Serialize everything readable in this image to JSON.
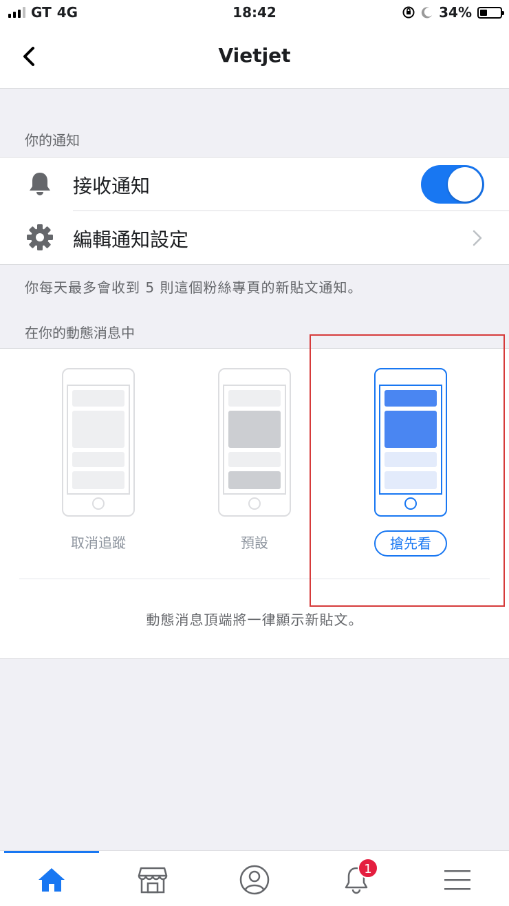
{
  "status_bar": {
    "carrier": "GT",
    "network": "4G",
    "time": "18:42",
    "battery": "34%",
    "battery_level": 0.34
  },
  "header": {
    "title": "Vietjet",
    "back_icon": "chevron-left-icon"
  },
  "notifications_section": {
    "header": "你的通知",
    "receive_label": "接收通知",
    "receive_enabled": true,
    "edit_label": "編輯通知設定",
    "note": "你每天最多會收到 5 則這個粉絲專頁的新貼文通知。"
  },
  "feed_section": {
    "header": "在你的動態消息中",
    "options": [
      {
        "label": "取消追蹤",
        "selected": false
      },
      {
        "label": "預設",
        "selected": false
      },
      {
        "label": "搶先看",
        "selected": true
      }
    ],
    "description": "動態消息頂端將一律顯示新貼文。"
  },
  "tab_bar": {
    "tabs": [
      {
        "icon": "home-icon",
        "active": true
      },
      {
        "icon": "marketplace-icon",
        "active": false
      },
      {
        "icon": "profile-icon",
        "active": false
      },
      {
        "icon": "bell-icon",
        "active": false,
        "badge": "1"
      },
      {
        "icon": "menu-icon",
        "active": false
      }
    ]
  },
  "colors": {
    "accent": "#1877f2",
    "highlight_box": "#d63a3a",
    "badge": "#e41e3f",
    "background": "#f0f0f5"
  }
}
